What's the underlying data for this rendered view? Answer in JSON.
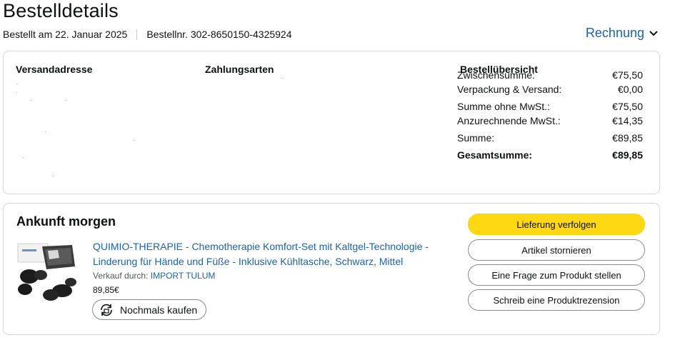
{
  "header": {
    "title": "Bestelldetails",
    "order_date": "Bestellt am 22. Januar 2025",
    "order_number": "Bestellnr. 302-8650150-4325924",
    "invoice_label": "Rechnung"
  },
  "details": {
    "shipping_heading": "Versandadresse",
    "payment_heading": "Zahlungsarten",
    "summary_heading": "Bestellübersicht",
    "summary_rows": [
      {
        "label": "Zwischensumme:",
        "value": "€75,50"
      },
      {
        "label": "Verpackung & Versand:",
        "value": "€0,00"
      },
      {
        "label": "Summe ohne MwSt.:",
        "value": "€75,50"
      },
      {
        "label": "Anzurechnende MwSt.:",
        "value": "€14,35"
      },
      {
        "label": "Summe:",
        "value": "€89,85"
      },
      {
        "label": "Gesamtsumme:",
        "value": "€89,85"
      }
    ]
  },
  "shipment": {
    "status": "Ankunft morgen",
    "product_title": "QUIMIO-THERAPIE - Chemotherapie Komfort-Set mit Kaltgel-Technologie - Linderung für Hände und Füße - Inklusive Kühltasche, Schwarz, Mittel",
    "seller_prefix": "Verkauf durch:",
    "seller_name": "IMPORT TULUM",
    "price": "89,85€",
    "rebuy_label": "Nochmals kaufen",
    "actions": {
      "track": "Lieferung verfolgen",
      "cancel": "Artikel stornieren",
      "question": "Eine Frage zum Produkt stellen",
      "review": "Schreib eine Produktrezension"
    }
  },
  "colors": {
    "link": "#2162a1",
    "primary_button": "#ffd814",
    "border": "#d5d9d9"
  },
  "icons": [
    "chevron-down-icon",
    "rebuy-icon",
    "product-thumbnail"
  ]
}
